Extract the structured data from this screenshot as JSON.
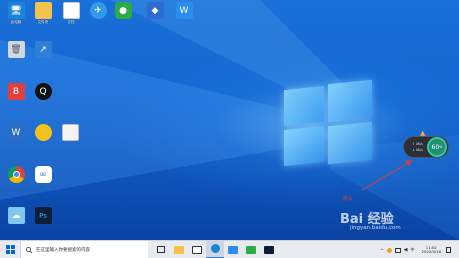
{
  "desktop": {
    "icons_top_row": [
      {
        "icon": "computer-icon",
        "label": "此电脑",
        "color": "#1a84d6"
      },
      {
        "icon": "folder-icon",
        "label": "",
        "color": "#f3c24d"
      },
      {
        "icon": "document-icon",
        "label": "",
        "color": "#ffffff"
      },
      {
        "icon": "feather-app-icon",
        "label": "",
        "color": "#2f9be8"
      },
      {
        "icon": "wechat-icon",
        "label": "",
        "color": "#2aae43"
      },
      {
        "icon": "app-shortcut-icon",
        "label": "",
        "color": "#2d6bd1"
      },
      {
        "icon": "wps-office-icon",
        "label": "",
        "color": "#2a8df0"
      }
    ],
    "icons_left_column": [
      {
        "icon": "recycle-bin-icon",
        "label": "",
        "color": "#cfd8e3"
      },
      {
        "icon": "app-blue-icon",
        "label": "",
        "color": "#2f7fd8"
      },
      {
        "icon": "baidu-netdisk-icon",
        "label": "",
        "color": "#e2403a"
      },
      {
        "icon": "qq-icon",
        "label": "",
        "color": "#111111"
      },
      {
        "icon": "word-doc-icon",
        "label": "",
        "color": "#2b6cc4"
      },
      {
        "icon": "app-yellow-icon",
        "label": "",
        "color": "#f0c21b"
      },
      {
        "icon": "file-icon",
        "label": "",
        "color": "#f3f3f3"
      },
      {
        "icon": "chrome-icon",
        "label": "",
        "color": "#db4437"
      },
      {
        "icon": "app-swirl-icon",
        "label": "",
        "color": "#ffffff"
      },
      {
        "icon": "cloud-icon",
        "label": "",
        "color": "#7fc6f0"
      },
      {
        "icon": "photoshop-icon",
        "label": "Ps",
        "color": "#0f1e35"
      }
    ]
  },
  "widget": {
    "row1": "↑ 0K/s",
    "row2": "↓ 0K/s",
    "percent": "60",
    "percent_suffix": "%",
    "accent": "#35c79d"
  },
  "annotation": {
    "label": "箭头",
    "color": "#e23a3a"
  },
  "taskbar": {
    "search_placeholder": "在这里输入你要搜索的内容",
    "tray_text": "^",
    "ime": "中",
    "time": "11:02",
    "date": "2020/4/16"
  },
  "watermark": {
    "brand": "Bai 经验",
    "url": "jingyan.baidu.com"
  }
}
